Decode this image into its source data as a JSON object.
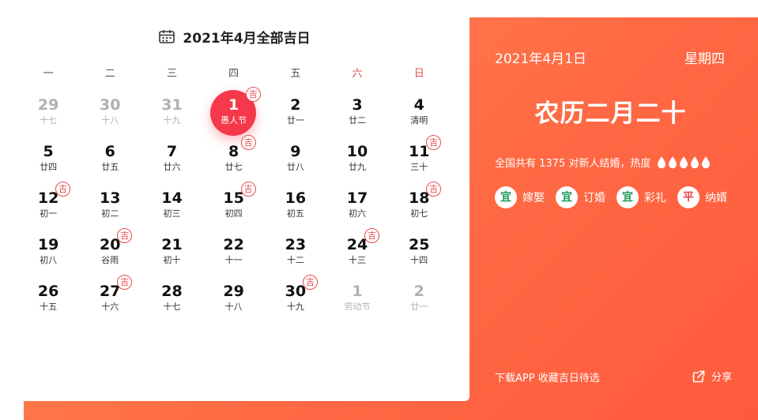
{
  "calendar": {
    "title": "2021年4月全部吉日",
    "weekdays": [
      {
        "label": "一",
        "weekend": false
      },
      {
        "label": "二",
        "weekend": false
      },
      {
        "label": "三",
        "weekend": false
      },
      {
        "label": "四",
        "weekend": false
      },
      {
        "label": "五",
        "weekend": false
      },
      {
        "label": "六",
        "weekend": true
      },
      {
        "label": "日",
        "weekend": true
      }
    ],
    "lucky_badge": "吉",
    "weeks": [
      [
        {
          "day": "29",
          "lunar": "十七",
          "other": true,
          "lucky": false,
          "today": false
        },
        {
          "day": "30",
          "lunar": "十八",
          "other": true,
          "lucky": false,
          "today": false
        },
        {
          "day": "31",
          "lunar": "十九",
          "other": true,
          "lucky": false,
          "today": false
        },
        {
          "day": "1",
          "lunar": "愚人节",
          "other": false,
          "lucky": true,
          "today": true
        },
        {
          "day": "2",
          "lunar": "廿一",
          "other": false,
          "lucky": false,
          "today": false
        },
        {
          "day": "3",
          "lunar": "廿二",
          "other": false,
          "lucky": false,
          "today": false
        },
        {
          "day": "4",
          "lunar": "清明",
          "other": false,
          "lucky": false,
          "today": false
        }
      ],
      [
        {
          "day": "5",
          "lunar": "廿四",
          "other": false,
          "lucky": false,
          "today": false
        },
        {
          "day": "6",
          "lunar": "廿五",
          "other": false,
          "lucky": false,
          "today": false
        },
        {
          "day": "7",
          "lunar": "廿六",
          "other": false,
          "lucky": false,
          "today": false
        },
        {
          "day": "8",
          "lunar": "廿七",
          "other": false,
          "lucky": true,
          "today": false
        },
        {
          "day": "9",
          "lunar": "廿八",
          "other": false,
          "lucky": false,
          "today": false
        },
        {
          "day": "10",
          "lunar": "廿九",
          "other": false,
          "lucky": false,
          "today": false
        },
        {
          "day": "11",
          "lunar": "三十",
          "other": false,
          "lucky": true,
          "today": false
        }
      ],
      [
        {
          "day": "12",
          "lunar": "初一",
          "other": false,
          "lucky": true,
          "today": false
        },
        {
          "day": "13",
          "lunar": "初二",
          "other": false,
          "lucky": false,
          "today": false
        },
        {
          "day": "14",
          "lunar": "初三",
          "other": false,
          "lucky": false,
          "today": false
        },
        {
          "day": "15",
          "lunar": "初四",
          "other": false,
          "lucky": true,
          "today": false
        },
        {
          "day": "16",
          "lunar": "初五",
          "other": false,
          "lucky": false,
          "today": false
        },
        {
          "day": "17",
          "lunar": "初六",
          "other": false,
          "lucky": false,
          "today": false
        },
        {
          "day": "18",
          "lunar": "初七",
          "other": false,
          "lucky": true,
          "today": false
        }
      ],
      [
        {
          "day": "19",
          "lunar": "初八",
          "other": false,
          "lucky": false,
          "today": false
        },
        {
          "day": "20",
          "lunar": "谷雨",
          "other": false,
          "lucky": true,
          "today": false
        },
        {
          "day": "21",
          "lunar": "初十",
          "other": false,
          "lucky": false,
          "today": false
        },
        {
          "day": "22",
          "lunar": "十一",
          "other": false,
          "lucky": false,
          "today": false
        },
        {
          "day": "23",
          "lunar": "十二",
          "other": false,
          "lucky": false,
          "today": false
        },
        {
          "day": "24",
          "lunar": "十三",
          "other": false,
          "lucky": true,
          "today": false
        },
        {
          "day": "25",
          "lunar": "十四",
          "other": false,
          "lucky": false,
          "today": false
        }
      ],
      [
        {
          "day": "26",
          "lunar": "十五",
          "other": false,
          "lucky": false,
          "today": false
        },
        {
          "day": "27",
          "lunar": "十六",
          "other": false,
          "lucky": true,
          "today": false
        },
        {
          "day": "28",
          "lunar": "十七",
          "other": false,
          "lucky": false,
          "today": false
        },
        {
          "day": "29",
          "lunar": "十八",
          "other": false,
          "lucky": false,
          "today": false
        },
        {
          "day": "30",
          "lunar": "十九",
          "other": false,
          "lucky": true,
          "today": false
        },
        {
          "day": "1",
          "lunar": "劳动节",
          "other": true,
          "lucky": false,
          "today": false
        },
        {
          "day": "2",
          "lunar": "廿一",
          "other": true,
          "lucky": false,
          "today": false
        }
      ]
    ]
  },
  "detail": {
    "date": "2021年4月1日",
    "weekday": "星期四",
    "lunar_date": "农历二月二十",
    "stats_text": "全国共有 1375 对新人结婚，热度",
    "heat_level": 5,
    "heat_max": 5,
    "tags": [
      {
        "badge": "宜",
        "label": "嫁娶",
        "kind": "good"
      },
      {
        "badge": "宜",
        "label": "订婚",
        "kind": "good"
      },
      {
        "badge": "宜",
        "label": "彩礼",
        "kind": "good"
      },
      {
        "badge": "平",
        "label": "纳婿",
        "kind": "neutral"
      }
    ],
    "download_text": "下载APP 收藏吉日待选",
    "share_label": "分享"
  },
  "colors": {
    "accent_red": "#f5384a",
    "panel_orange": "#ff6a45",
    "good_green": "#1e9a5a"
  },
  "icons": {
    "header": "calendar-icon",
    "heat": "drop-icon",
    "share": "share-icon"
  }
}
